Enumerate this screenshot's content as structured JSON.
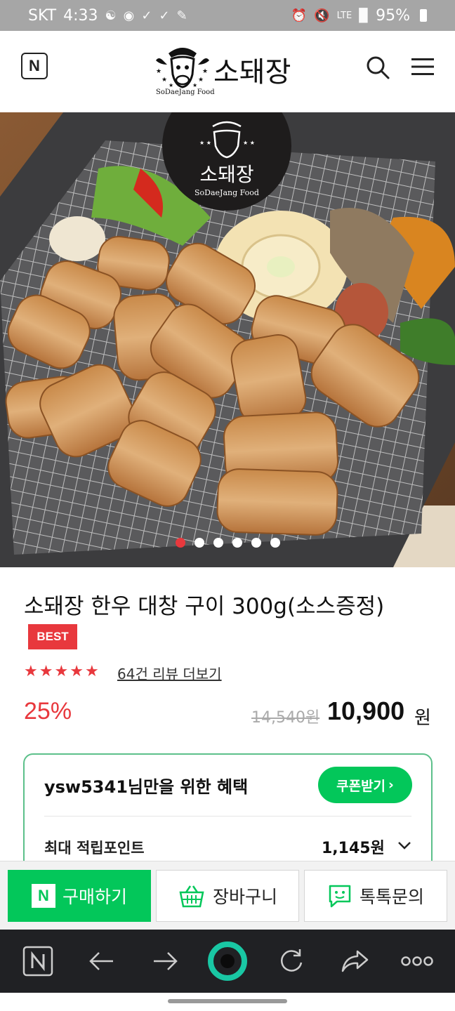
{
  "status_bar": {
    "carrier": "SKT",
    "time": "4:33",
    "network": "LTE",
    "battery": "95%"
  },
  "header": {
    "naver_logo": "N",
    "brand_name": "소돼장",
    "brand_sub": "SoDaeJang Food"
  },
  "hero": {
    "badge_name": "소돼장",
    "badge_sub": "SoDaeJang Food",
    "slide_count": 6,
    "active_slide": 1
  },
  "product": {
    "title": "소돼장 한우 대창 구이 300g(소스증정)",
    "badge": "BEST",
    "rating": 5,
    "reviews": "64건 리뷰 더보기",
    "discount": "25%",
    "original_price": "14,540원",
    "sale_price": "10,900",
    "currency": "원"
  },
  "benefit": {
    "title": "ysw5341님만을 위한 혜택",
    "coupon_button": "쿠폰받기",
    "points_label": "최대 적립포인트",
    "points_value": "1,145원"
  },
  "actions": {
    "buy": "구매하기",
    "buy_icon": "N",
    "cart": "장바구니",
    "talk": "톡톡문의"
  },
  "colors": {
    "brand_green": "#03c75a",
    "sale_red": "#e8383d",
    "benefit_border": "#5cc08a"
  }
}
